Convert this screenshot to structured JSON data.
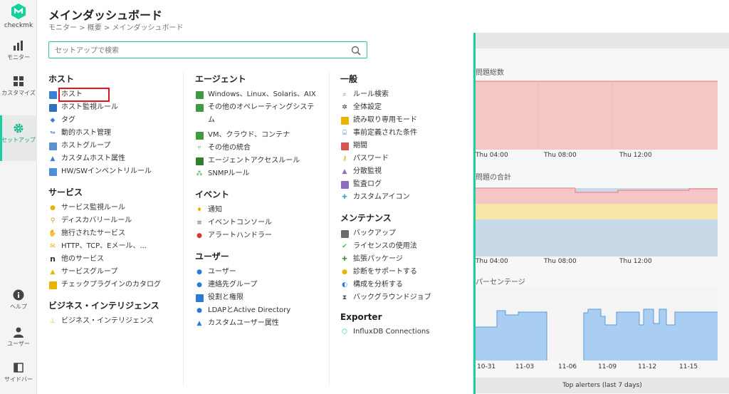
{
  "app": {
    "logo_text": "checkmk"
  },
  "nav": {
    "items": [
      {
        "label": "モニター",
        "icon": "bar-chart-icon"
      },
      {
        "label": "カスタマイズ",
        "icon": "grid-icon"
      },
      {
        "label": "セットアップ",
        "icon": "gear-icon",
        "active": true
      },
      {
        "label": "ヘルプ",
        "icon": "info-icon"
      },
      {
        "label": "ユーザー",
        "icon": "user-icon"
      },
      {
        "label": "サイドバー",
        "icon": "sidebar-icon"
      }
    ]
  },
  "header": {
    "title": "メインダッシュボード",
    "breadcrumb": "モニター > 概要 > メインダッシュボード"
  },
  "search": {
    "placeholder": "セットアップで検索"
  },
  "menu": {
    "hosts": {
      "title": "ホスト",
      "items": [
        "ホスト",
        "ホスト監視ルール",
        "タグ",
        "動的ホスト管理",
        "ホストグループ",
        "カスタムホスト属性",
        "HW/SWインベントリルール"
      ]
    },
    "services": {
      "title": "サービス",
      "items": [
        "サービス監視ルール",
        "ディスカバリールール",
        "施行されたサービス",
        "HTTP、TCP、Eメール、...",
        "他のサービス",
        "サービスグループ",
        "チェックプラグインのカタログ"
      ]
    },
    "bi": {
      "title": "ビジネス・インテリジェンス",
      "items": [
        "ビジネス・インテリジェンス"
      ]
    },
    "agents": {
      "title": "エージェント",
      "items": [
        "Windows、Linux、Solaris、AIX",
        "その他のオペレーティングシステム",
        "VM、クラウド、コンテナ",
        "その他の統合",
        "エージェントアクセスルール",
        "SNMPルール"
      ]
    },
    "events": {
      "title": "イベント",
      "items": [
        "通知",
        "イベントコンソール",
        "アラートハンドラー"
      ]
    },
    "users": {
      "title": "ユーザー",
      "items": [
        "ユーザー",
        "連絡先グループ",
        "役割と権限",
        "LDAPとActive Directory",
        "カスタムユーザー属性"
      ]
    },
    "general": {
      "title": "一般",
      "items": [
        "ルール検索",
        "全体設定",
        "読み取り専用モード",
        "事前定義された条件",
        "期間",
        "パスワード",
        "分散監視",
        "監査ログ",
        "カスタムアイコン"
      ]
    },
    "maintenance": {
      "title": "メンテナンス",
      "items": [
        "バックアップ",
        "ライセンスの使用法",
        "拡張パッケージ",
        "診断をサポートする",
        "構成を分析する",
        "バックグラウンドジョブ"
      ]
    },
    "exporter": {
      "title": "Exporter",
      "items": [
        "InfluxDB Connections"
      ]
    }
  },
  "dashboard": {
    "dashlet1_title": "問題総数",
    "dashlet2_title": "問題の合計",
    "dashlet3_title": "パーセンテージ",
    "time_ticks": [
      "Thu 04:00",
      "Thu 08:00",
      "Thu 12:00"
    ],
    "date_ticks": [
      "10-31",
      "11-03",
      "11-06",
      "11-09",
      "11-12",
      "11-15"
    ],
    "footer": "Top alerters (last 7 days)"
  },
  "colors": {
    "accent": "#15d1a0",
    "highlight": "#e5141a"
  }
}
